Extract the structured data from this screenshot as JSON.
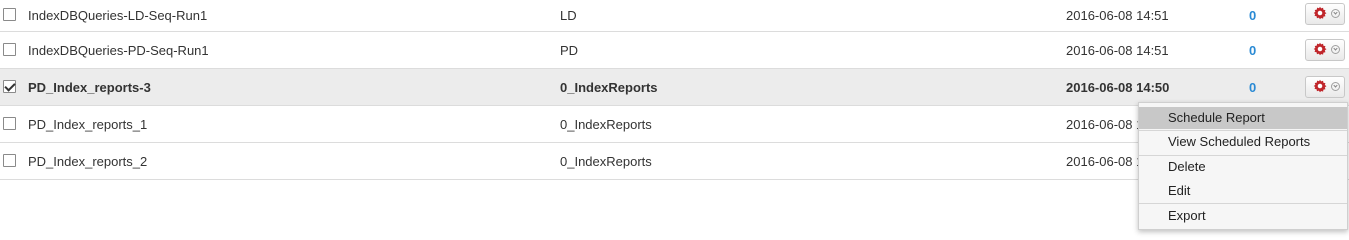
{
  "rows": [
    {
      "name": "IndexDBQueries-LD-Seq-Run1",
      "type": "LD",
      "date": "2016-06-08 14:51",
      "count": "0",
      "checked": false
    },
    {
      "name": "IndexDBQueries-PD-Seq-Run1",
      "type": "PD",
      "date": "2016-06-08 14:51",
      "count": "0",
      "checked": false
    },
    {
      "name": "PD_Index_reports-3",
      "type": "0_IndexReports",
      "date": "2016-06-08 14:50",
      "count": "0",
      "checked": true
    },
    {
      "name": "PD_Index_reports_1",
      "type": "0_IndexReports",
      "date": "2016-06-08 1",
      "checked": false
    },
    {
      "name": "PD_Index_reports_2",
      "type": "0_IndexReports",
      "date": "2016-06-08 1",
      "checked": false
    }
  ],
  "context_menu": {
    "items": [
      "Schedule Report",
      "View Scheduled Reports",
      "Delete",
      "Edit",
      "Export"
    ]
  },
  "colors": {
    "count": "#2a8ad4",
    "gear": "#c0262b",
    "selected_row": "#ececec"
  },
  "icons": {
    "settings": "gear-icon",
    "dropdown": "chevron-down-icon",
    "check": "checkbox"
  }
}
